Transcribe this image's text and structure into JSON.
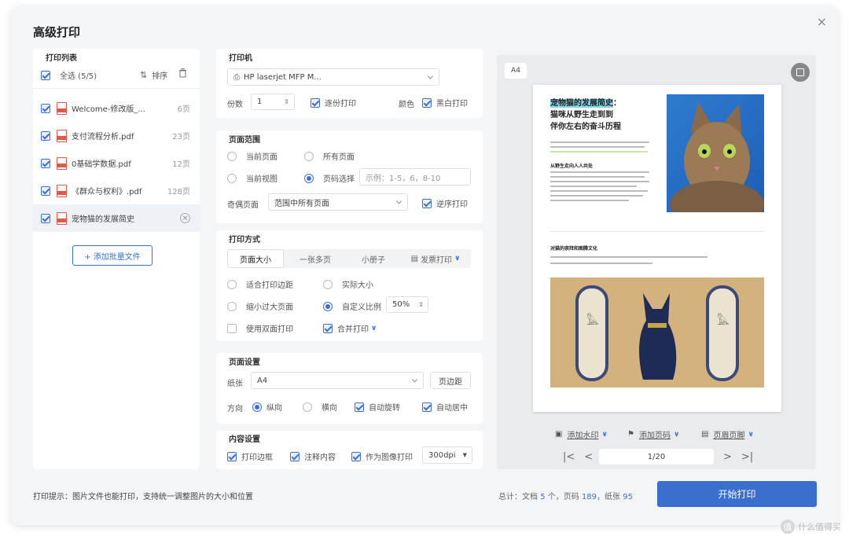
{
  "dialog": {
    "title": "高级打印",
    "close": "×"
  },
  "print_list": {
    "title": "打印列表",
    "select_all": "全选 (5/5)",
    "sort": "排序",
    "files": [
      {
        "name": "Welcome-修改版_...",
        "pages": "6页"
      },
      {
        "name": "支付流程分析.pdf",
        "pages": "23页"
      },
      {
        "name": "0基础学数据.pdf",
        "pages": "12页"
      },
      {
        "name": "《群众与权利》.pdf",
        "pages": "128页"
      },
      {
        "name": "宠物猫的发展简史",
        "pages": ""
      }
    ],
    "add_button": "+ 添加批量文件"
  },
  "printer": {
    "title": "打印机",
    "selected": "HP laserjet MFP M...",
    "copies_label": "份数",
    "copies_value": "1",
    "collate": "逐份打印",
    "color_label": "颜色",
    "bw": "黑白打印"
  },
  "page_range": {
    "title": "页面范围",
    "current_page": "当前页面",
    "all_pages": "所有页面",
    "current_view": "当前视图",
    "page_select": "页码选择",
    "page_select_placeholder": "示例：1-5，6，8-10",
    "odd_even_label": "奇偶页面",
    "odd_even_value": "范围中所有页面",
    "reverse": "逆序打印"
  },
  "print_mode": {
    "title": "打印方式",
    "tabs": [
      "页面大小",
      "一张多页",
      "小册子",
      "发票打印"
    ],
    "fit_margin": "适合打印边距",
    "actual_size": "实际大小",
    "shrink": "缩小过大页面",
    "custom_scale": "自定义比例",
    "scale_value": "50%",
    "duplex": "使用双面打印",
    "merge": "合并打印"
  },
  "page_setup": {
    "title": "页面设置",
    "paper_label": "纸张",
    "paper_value": "A4",
    "margin_button": "页边距",
    "direction_label": "方向",
    "portrait": "纵向",
    "landscape": "横向",
    "auto_rotate": "自动旋转",
    "auto_center": "自动居中"
  },
  "content_setup": {
    "title": "内容设置",
    "border": "打印边框",
    "annotation": "注释内容",
    "as_image": "作为图像打印",
    "dpi": "300dpi"
  },
  "preview": {
    "paper": "A4",
    "doc_title_highlight": "宠物猫的发展简史",
    "doc_title_rest": "：",
    "doc_title_line2": "猫咪从野生走到到",
    "doc_title_line3": "伴你左右的奋斗历程",
    "section1_heading": "从野生走向人人共处",
    "section2_heading": "对猫的崇拜和图腾文化",
    "watermark_tool": "添加水印",
    "stamp_tool": "添加页码",
    "header_footer_tool": "页眉页脚",
    "page_indicator": "1/20"
  },
  "footer": {
    "hint": "打印提示：图片文件也能打印，支持统一调整图片的大小和位置",
    "stats_prefix": "总计：文档",
    "docs": "5",
    "stats_mid1": "个，页码",
    "pages": "189",
    "stats_mid2": "，纸张",
    "sheets": "95",
    "start": "开始打印"
  },
  "site_watermark": "什么值得买",
  "colors": {
    "accent": "#3a70d4",
    "pdf_red": "#e05a4a"
  },
  "icons": [
    "close-icon",
    "sort-icon",
    "trash-icon",
    "printer-icon",
    "pdf-icon",
    "remove-icon",
    "chevron-down-icon",
    "watermark-icon",
    "page-number-icon",
    "header-footer-icon",
    "first-page-icon",
    "prev-page-icon",
    "next-page-icon",
    "last-page-icon",
    "fullscreen-icon"
  ]
}
